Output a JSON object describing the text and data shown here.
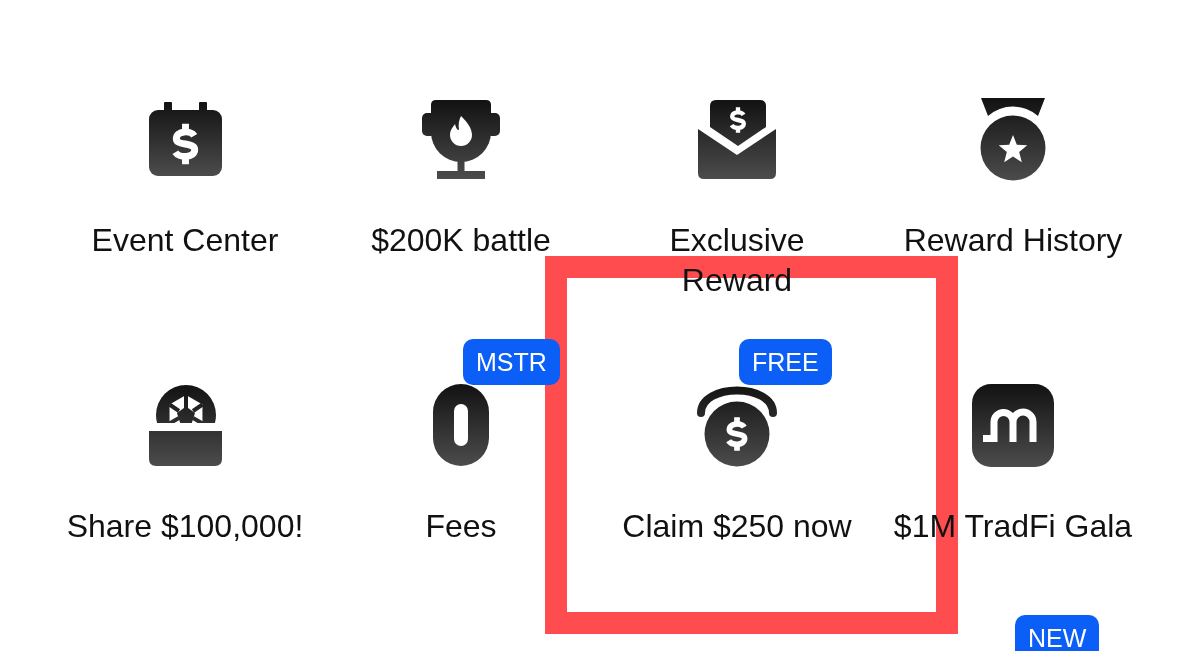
{
  "menu": {
    "rows": [
      {
        "items": [
          {
            "label": "Event Center",
            "highlighted": false
          },
          {
            "label": "$200K battle",
            "highlighted": false
          },
          {
            "label": "Exclusive Reward",
            "highlighted": false
          },
          {
            "label": "Reward History",
            "highlighted": false
          }
        ]
      },
      {
        "items": [
          {
            "label": "Share $100,000!",
            "highlighted": false
          },
          {
            "label": "Fees",
            "badge": "MSTR",
            "highlighted": false
          },
          {
            "label": "Claim $250 now",
            "badge": "FREE",
            "highlighted": true
          },
          {
            "label": "$1M TradFi Gala",
            "highlighted": false
          }
        ]
      }
    ],
    "partial_row": {
      "badge": "NEW"
    }
  }
}
